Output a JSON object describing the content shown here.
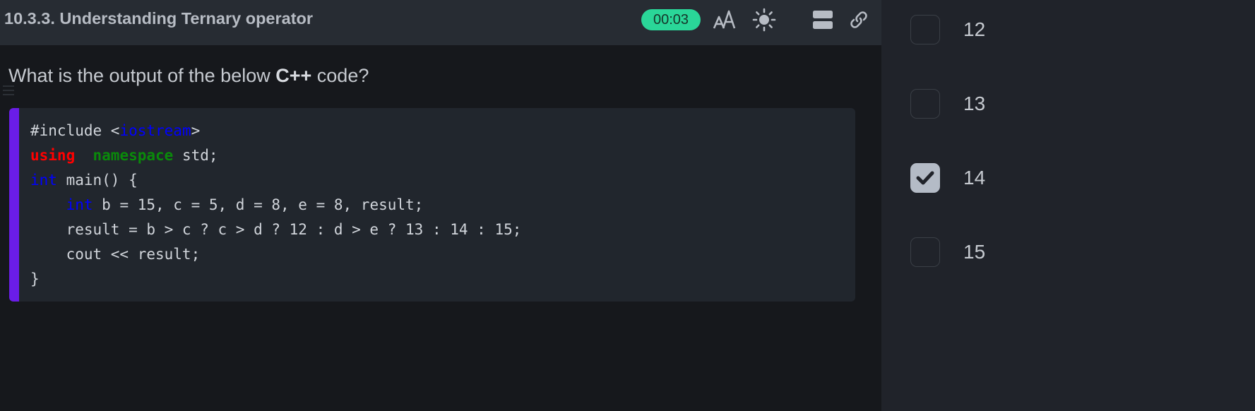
{
  "header": {
    "title": "10.3.3. Understanding Ternary operator",
    "timer": "00:03",
    "icons": {
      "font": "font-size-icon",
      "theme": "sun-icon",
      "layout": "split-layout-icon",
      "link": "link-icon"
    }
  },
  "question": {
    "prefix": "What is the output of the below ",
    "language": "C++",
    "suffix": " code?"
  },
  "code": {
    "lines": [
      [
        {
          "t": "#include <",
          "c": ""
        },
        {
          "t": "iostream",
          "c": "lib"
        },
        {
          "t": ">",
          "c": ""
        }
      ],
      [
        {
          "t": "using",
          "c": "kw"
        },
        {
          "t": "  ",
          "c": ""
        },
        {
          "t": "namespace",
          "c": "ns"
        },
        {
          "t": " std;",
          "c": ""
        }
      ],
      [
        {
          "t": "int",
          "c": "type"
        },
        {
          "t": " main() {",
          "c": ""
        }
      ],
      [
        {
          "t": "    ",
          "c": ""
        },
        {
          "t": "int",
          "c": "type"
        },
        {
          "t": " b = 15, c = 5, d = 8, e = 8, result;",
          "c": ""
        }
      ],
      [
        {
          "t": "    result = b > c ? c > d ? 12 : d > e ? 13 : 14 : 15;",
          "c": ""
        }
      ],
      [
        {
          "t": "    cout << result;",
          "c": ""
        }
      ],
      [
        {
          "t": "}",
          "c": ""
        }
      ]
    ]
  },
  "options": [
    {
      "label": "12",
      "checked": false
    },
    {
      "label": "13",
      "checked": false
    },
    {
      "label": "14",
      "checked": true
    },
    {
      "label": "15",
      "checked": false
    }
  ],
  "colors": {
    "accent_bar": "#6a1de8",
    "timer_bg": "#2ad698",
    "keyword": "#ff0000",
    "namespace": "#0a8a0a",
    "type": "#0000ff"
  }
}
